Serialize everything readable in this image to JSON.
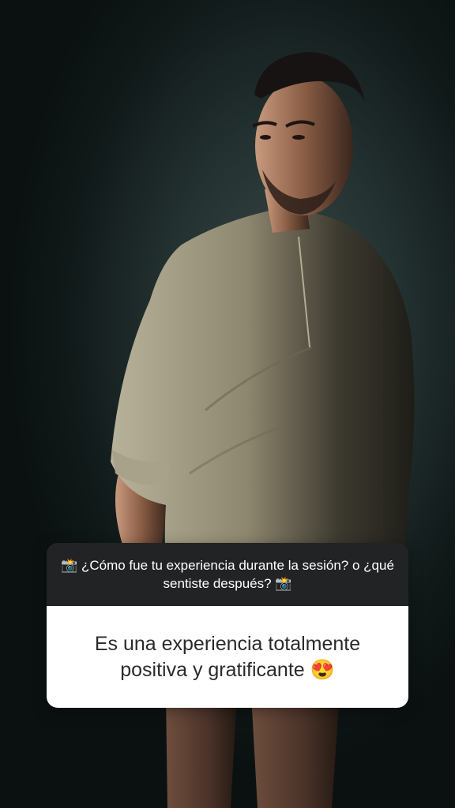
{
  "story": {
    "question": {
      "text": "📸 ¿Cómo fue tu experiencia durante la sesión? o ¿qué sentiste después? 📸"
    },
    "answer": {
      "text": "Es una experiencia totalmente positiva y gratificante 😍"
    }
  },
  "colors": {
    "question_bg": "#222325",
    "answer_bg": "#ffffff",
    "backdrop": "#2f3d3c"
  }
}
